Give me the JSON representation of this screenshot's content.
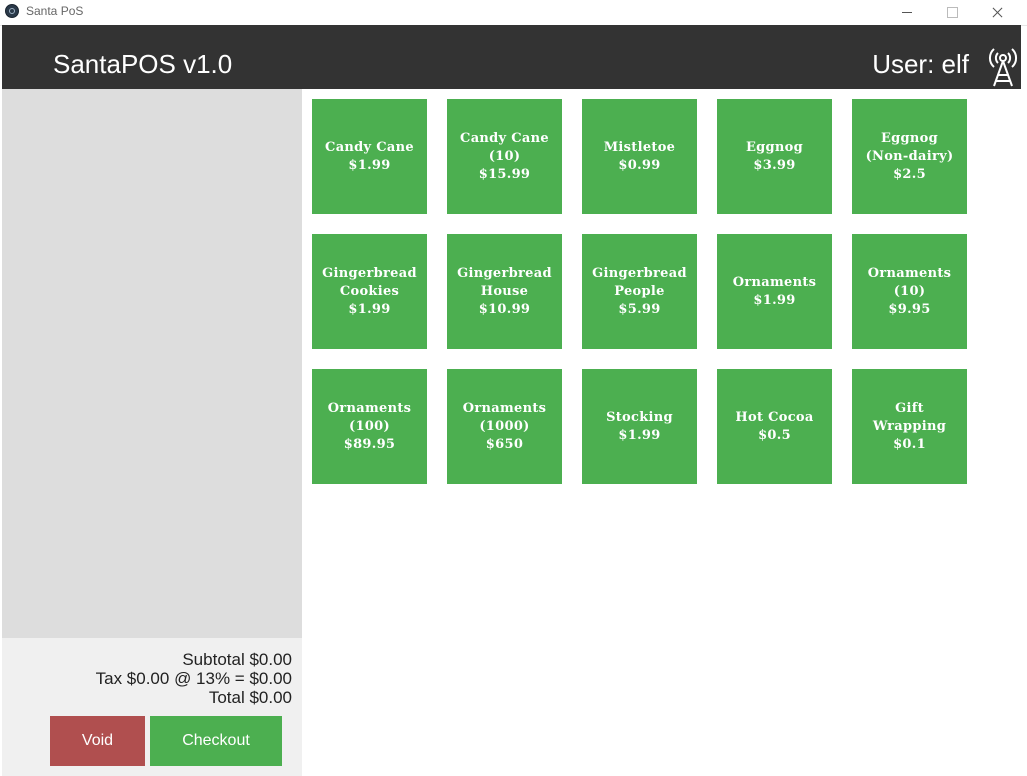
{
  "window": {
    "title": "Santa PoS"
  },
  "header": {
    "app_title": "SantaPOS v1.0",
    "user_label": "User: elf",
    "antenna_icon": "radio-tower-icon"
  },
  "totals": {
    "subtotal": "Subtotal $0.00",
    "tax": "Tax $0.00 @ 13% = $0.00",
    "total": "Total $0.00"
  },
  "buttons": {
    "void": "Void",
    "checkout": "Checkout"
  },
  "colors": {
    "header_bg": "#333333",
    "tile_green": "#4caf50",
    "void_red": "#b04f4f",
    "sidebar_bg": "#dddddd"
  },
  "products": [
    {
      "name": "Candy Cane",
      "price": "$1.99"
    },
    {
      "name": "Candy Cane\n(10)",
      "price": "$15.99"
    },
    {
      "name": "Mistletoe",
      "price": "$0.99"
    },
    {
      "name": "Eggnog",
      "price": "$3.99"
    },
    {
      "name": "Eggnog\n(Non-dairy)",
      "price": "$2.5"
    },
    {
      "name": "Gingerbread\nCookies",
      "price": "$1.99"
    },
    {
      "name": "Gingerbread\nHouse",
      "price": "$10.99"
    },
    {
      "name": "Gingerbread\nPeople",
      "price": "$5.99"
    },
    {
      "name": "Ornaments",
      "price": "$1.99"
    },
    {
      "name": "Ornaments\n(10)",
      "price": "$9.95"
    },
    {
      "name": "Ornaments\n(100)",
      "price": "$89.95"
    },
    {
      "name": "Ornaments\n(1000)",
      "price": "$650"
    },
    {
      "name": "Stocking",
      "price": "$1.99"
    },
    {
      "name": "Hot Cocoa",
      "price": "$0.5"
    },
    {
      "name": "Gift\nWrapping",
      "price": "$0.1"
    }
  ]
}
